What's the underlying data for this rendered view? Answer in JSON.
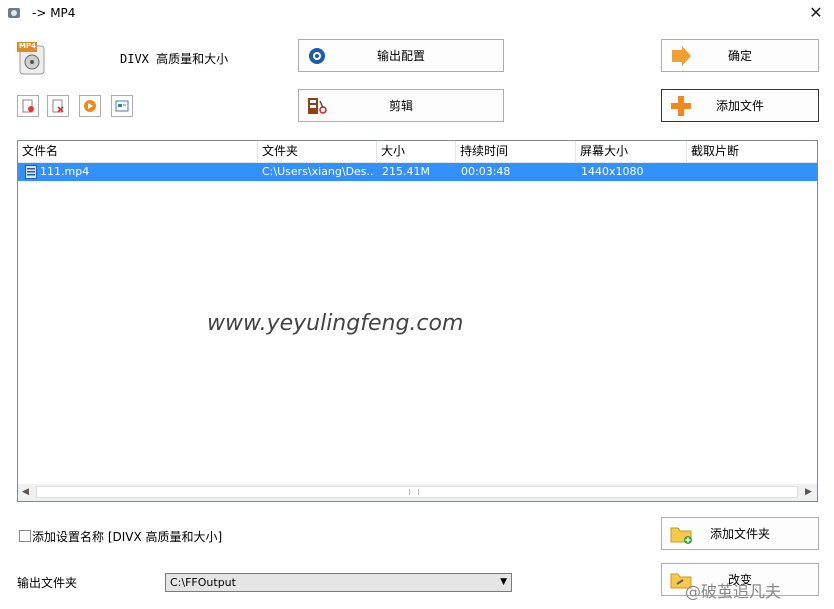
{
  "window": {
    "title": "-> MP4"
  },
  "preset": {
    "name": "DIVX 高质量和大小",
    "format_badge": "MP4"
  },
  "buttons": {
    "output_settings": "输出配置",
    "edit": "剪辑",
    "ok": "确定",
    "add_file": "添加文件",
    "add_folder": "添加文件夹",
    "change": "改变"
  },
  "table": {
    "columns": [
      "文件名",
      "文件夹",
      "大小",
      "持续时间",
      "屏幕大小",
      "截取片断"
    ],
    "rows": [
      {
        "name": "111.mp4",
        "folder": "C:\\Users\\xiang\\Des...",
        "size": "215.41M",
        "duration": "00:03:48",
        "screen": "1440x1080",
        "clip": ""
      }
    ]
  },
  "watermark": "www.yeyulingfeng.com",
  "options": {
    "add_setting_name_label": "添加设置名称 [DIVX 高质量和大小]",
    "add_setting_name_checked": false
  },
  "output": {
    "label": "输出文件夹",
    "path": "C:\\FFOutput"
  },
  "overlay": {
    "weibo_text": "@破茧追凡夫"
  }
}
